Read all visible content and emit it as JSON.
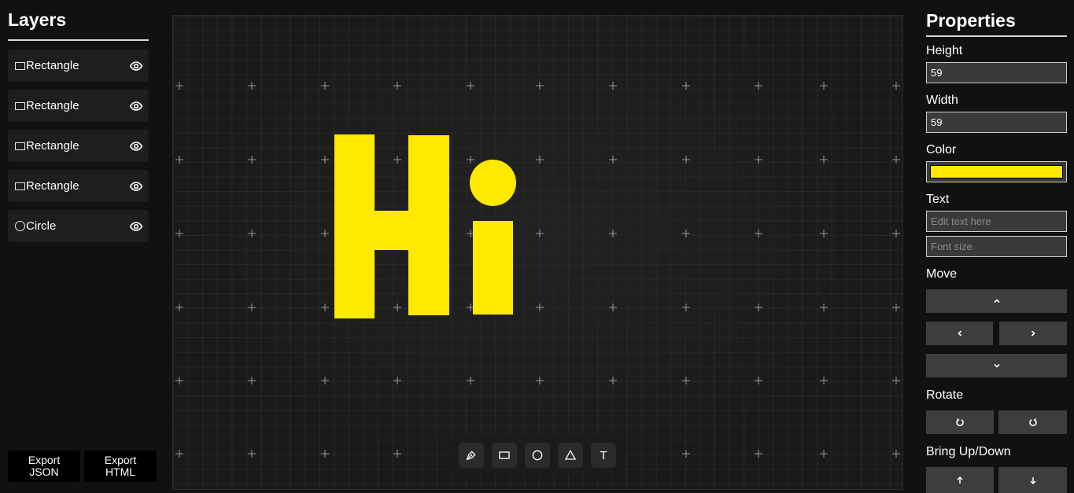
{
  "layers": {
    "title": "Layers",
    "items": [
      {
        "label": "Rectangle",
        "shape": "rectangle-icon"
      },
      {
        "label": "Rectangle",
        "shape": "rectangle-icon"
      },
      {
        "label": "Rectangle",
        "shape": "rectangle-icon"
      },
      {
        "label": "Rectangle",
        "shape": "rectangle-icon"
      },
      {
        "label": "Circle",
        "shape": "circle-icon"
      }
    ],
    "visibility_icon": "eye-icon",
    "export_json": [
      "Export",
      "JSON"
    ],
    "export_html": [
      "Export",
      "HTML"
    ]
  },
  "canvas": {
    "shape_color": "#FFE900",
    "toolbar": [
      "pen-tool-icon",
      "rectangle-tool-icon",
      "circle-tool-icon",
      "triangle-tool-icon",
      "text-tool-icon"
    ],
    "toolbar_text_glyph": "T"
  },
  "properties": {
    "title": "Properties",
    "height_label": "Height",
    "height_value": "59",
    "width_label": "Width",
    "width_value": "59",
    "color_label": "Color",
    "color_value": "#FFE900",
    "text_label": "Text",
    "text_placeholder": "Edit text here",
    "font_size_placeholder": "Font size",
    "move_label": "Move",
    "move_buttons": [
      "chevron-up-icon",
      "chevron-left-icon",
      "chevron-right-icon",
      "chevron-down-icon"
    ],
    "rotate_label": "Rotate",
    "rotate_buttons": [
      "rotate-left-icon",
      "rotate-right-icon"
    ],
    "layer_order_label": "Bring Up/Down",
    "layer_order_buttons": [
      "arrow-up-icon",
      "arrow-down-icon"
    ]
  }
}
